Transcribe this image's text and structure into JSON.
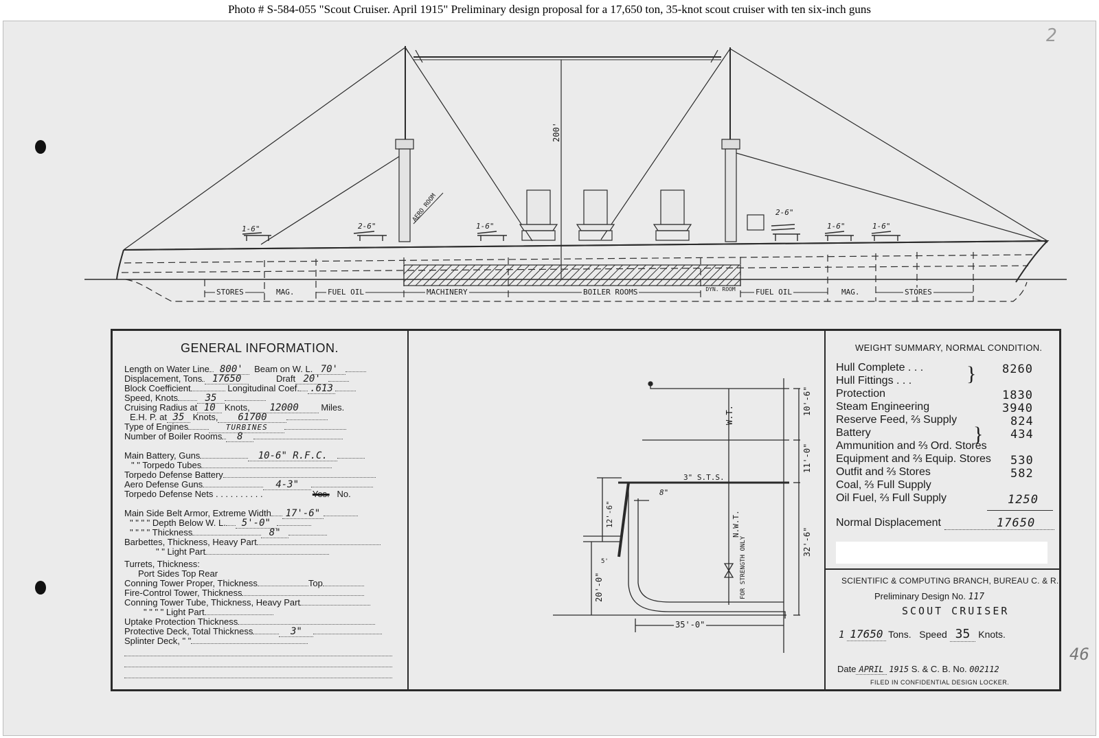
{
  "caption": "Photo #  S-584-055     \"Scout Cruiser.  April 1915\"   Preliminary design proposal for a 17,650 ton, 35-knot scout cruiser with ten six-inch guns",
  "corner_marks": {
    "top_right": "2",
    "right_margin": "46"
  },
  "profile": {
    "height_label": "200'",
    "aero_room": "AERO ROOM",
    "gun_labels": [
      "1-6\"",
      "2-6\"",
      "1-6\"",
      "2-6\"",
      "1-6\"",
      "1-6\""
    ],
    "compartments": [
      "STORES",
      "MAG.",
      "FUEL OIL",
      "MACHINERY",
      "BOILER ROOMS",
      "DYN. ROOM",
      "FUEL OIL",
      "MAG.",
      "STORES"
    ]
  },
  "general_info": {
    "title": "GENERAL INFORMATION.",
    "length_label": "Length on Water Line",
    "length": "800'",
    "beam_label": "Beam on W. L.",
    "beam": "70'",
    "displacement_label": "Displacement, Tons",
    "displacement": "17650",
    "draft_label": "Draft",
    "draft": "20'",
    "block_label": "Block Coefficient",
    "long_label": "Longitudinal Coef.",
    "long_coef": ".613",
    "speed_label": "Speed, Knots",
    "speed": "35",
    "radius_label": "Cruising Radius at",
    "radius_knots": "10",
    "knots_word": "Knots,",
    "radius_miles": "12000",
    "miles_word": "Miles.",
    "ehp_label": "E.H. P. at",
    "ehp_knots": "35",
    "ehp_value": "61700",
    "engines_label": "Type of Engines",
    "engines": "TURBINES",
    "boiler_label": "Number of Boiler Rooms",
    "boiler_rooms": "8",
    "main_battery_label": "Main Battery, Guns",
    "main_battery": "10-6\"  R.F.C.",
    "torpedo_tubes_label": "\"      \"      Torpedo Tubes",
    "tdb_label": "Torpedo Defense Battery",
    "aero_label": "Aero Defense Guns",
    "aero_guns": "4-3\"",
    "nets_label": "Torpedo Defense Nets . . . . . . . . . .",
    "nets_yes": "Yes.",
    "nets_no": "No.",
    "belt_width_label": "Main Side Belt Armor, Extreme Width",
    "belt_width": "17'-6\"",
    "belt_depth_label": "\"    \"    \"    \"    Depth Below W. L.",
    "belt_depth": "5'-0\"",
    "belt_thick_label": "\"    \"    \"    \"    Thickness",
    "belt_thick": "8\"",
    "barbette_label": "Barbettes, Thickness, Heavy Part",
    "light_part_label": "\"       \"      Light Part",
    "turrets_label": "Turrets, Thickness:",
    "turret_parts": "Port              Sides              Top                  Rear",
    "conning_label": "Conning Tower Proper, Thickness",
    "conning_top": "Top",
    "fire_label": "Fire-Control Tower, Thickness",
    "tube_label": "Conning Tower Tube, Thickness, Heavy Part",
    "tube_light_label": "\"       \"       \"       \"       Light Part",
    "uptake_label": "Uptake Protection Thickness",
    "deck_label": "Protective Deck, Total Thickness",
    "deck": "3\"",
    "splinter_label": "Splinter Deck,     \"        \""
  },
  "section": {
    "wt": "W.T.",
    "dim_top": "10'-6\"",
    "dim_mid": "11'-0\"",
    "sts": "3\" S.T.S.",
    "nwt": "N.W.T.",
    "nwt_note": "FOR STRENGTH ONLY",
    "belt": "8\"",
    "dim_side": "32'-6\"",
    "dim_belt": "12'-6\"",
    "dim_small": "5'",
    "draft": "20'-0\"",
    "half_beam": "35'-0\""
  },
  "weight_summary": {
    "title": "WEIGHT SUMMARY, NORMAL CONDITION.",
    "rows": [
      {
        "label": "Hull Complete  .  .  .",
        "value": "8260"
      },
      {
        "label": "Hull Fittings  .  .  .",
        "value": ""
      },
      {
        "label": "Protection",
        "value": "1830"
      },
      {
        "label": "Steam Engineering",
        "value": "3940"
      },
      {
        "label": "Reserve Feed, ⅔ Supply",
        "value": "824"
      },
      {
        "label": "Battery",
        "value": "434"
      },
      {
        "label": "Ammunition and ⅔ Ord. Stores",
        "value": ""
      },
      {
        "label": "Equipment and ⅔ Equip. Stores",
        "value": "530"
      },
      {
        "label": "Outfit and ⅔ Stores",
        "value": "582"
      },
      {
        "label": "Coal, ⅔ Full Supply",
        "value": ""
      },
      {
        "label": "Oil Fuel, ⅔ Full Supply",
        "value": "1250"
      }
    ],
    "normal_label": "Normal Displacement",
    "normal_value": "17650"
  },
  "title_block": {
    "branch": "SCIENTIFIC & COMPUTING BRANCH, BUREAU C. & R.",
    "design_label": "Preliminary Design No.",
    "design_no": "117",
    "ship": "SCOUT  CRUISER",
    "tons_prefix": "1",
    "tons": "17650",
    "tons_label": "Tons.",
    "speed_label": "Speed",
    "speed": "35",
    "knots_label": "Knots.",
    "date_label": "Date",
    "date": "APRIL",
    "year": "1915",
    "scb_label": "S. & C. B. No.",
    "scb": "002112",
    "filed": "FILED IN CONFIDENTIAL DESIGN LOCKER."
  }
}
